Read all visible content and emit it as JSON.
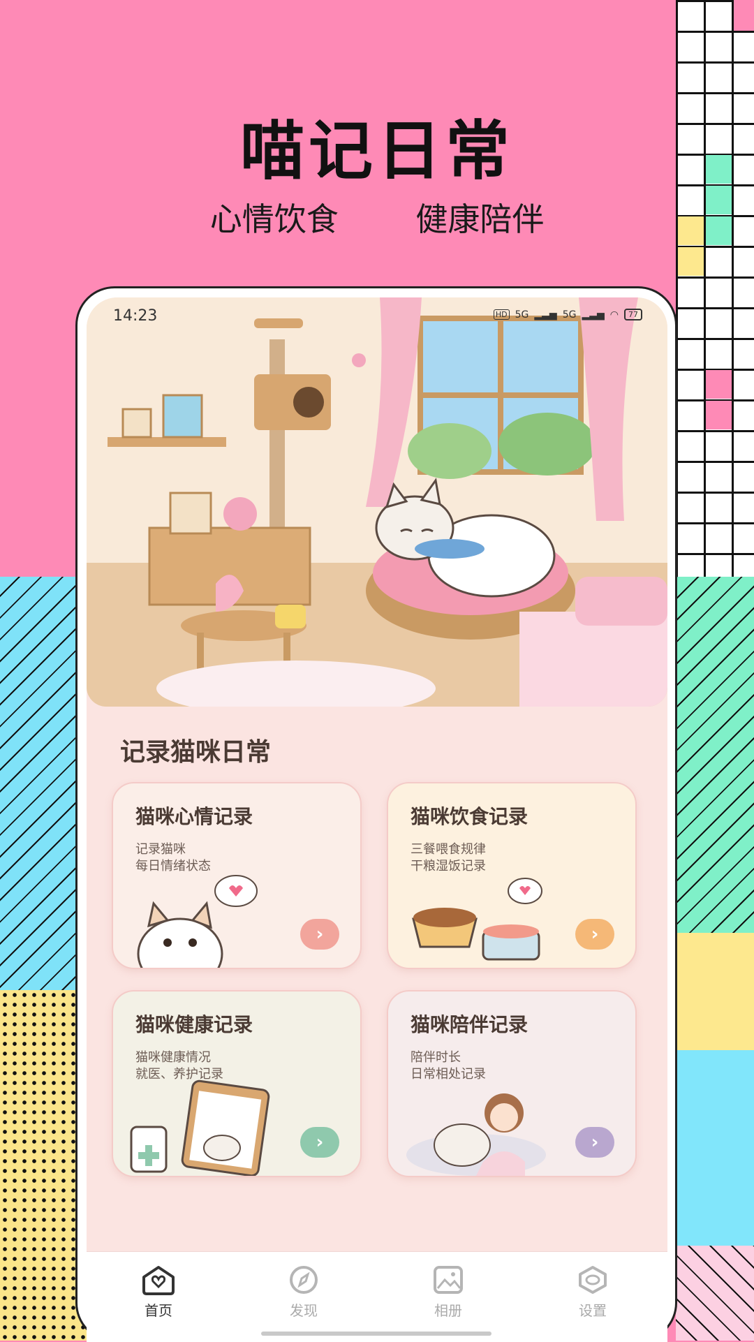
{
  "promo": {
    "headline": "喵记日常",
    "subline_left": "心情饮食",
    "subline_right": "健康陪伴"
  },
  "status_bar": {
    "time": "14:23",
    "network_1": "5G",
    "network_2": "5G",
    "battery": "77"
  },
  "section_title": "记录猫咪日常",
  "cards": [
    {
      "title": "猫咪心情记录",
      "line1": "记录猫咪",
      "line2": "每日情绪状态",
      "accent": "#f2a59c"
    },
    {
      "title": "猫咪饮食记录",
      "line1": "三餐喂食规律",
      "line2": "干粮湿饭记录",
      "accent": "#f5b877"
    },
    {
      "title": "猫咪健康记录",
      "line1": "猫咪健康情况",
      "line2": "就医、养护记录",
      "accent": "#8fc9ad"
    },
    {
      "title": "猫咪陪伴记录",
      "line1": "陪伴时长",
      "line2": "日常相处记录",
      "accent": "#b9a7cf"
    }
  ],
  "tabs": [
    {
      "label": "首页",
      "icon": "heart-home-icon",
      "active": true
    },
    {
      "label": "发现",
      "icon": "compass-icon",
      "active": false
    },
    {
      "label": "相册",
      "icon": "image-icon",
      "active": false
    },
    {
      "label": "设置",
      "icon": "settings-eye-icon",
      "active": false
    }
  ],
  "colors": {
    "background_pink": "#fe8ab6",
    "screen_bg": "#fbe4e1",
    "text_brown": "#4a3a33"
  }
}
